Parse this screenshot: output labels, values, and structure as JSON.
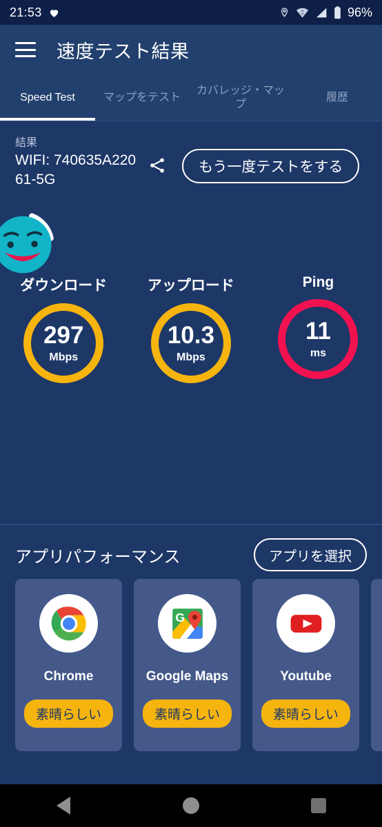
{
  "status_bar": {
    "time": "21:53",
    "battery_percent": "96%",
    "icons": [
      "heart-icon",
      "location-pin-icon",
      "wifi-icon",
      "cellular-signal-icon",
      "battery-icon"
    ]
  },
  "app_bar": {
    "menu_icon": "hamburger-menu-icon",
    "title": "速度テスト結果"
  },
  "tabs": [
    {
      "label": "Speed Test",
      "active": true
    },
    {
      "label": "マップをテスト",
      "active": false
    },
    {
      "label": "カバレッジ・マップ",
      "active": false
    },
    {
      "label": "履歴",
      "active": false
    }
  ],
  "result": {
    "label": "結果",
    "ssid": "WIFI: 740635A22061-5G",
    "share_icon": "share-icon",
    "retest_label": "もう一度テストをする"
  },
  "mascot": {
    "name": "happy-face-mascot",
    "face_color": "#12b4c8",
    "mouth_color": "#e8174a"
  },
  "gauges": [
    {
      "label": "ダウンロード",
      "value": "297",
      "unit": "Mbps",
      "color": "#f6b40f"
    },
    {
      "label": "アップロード",
      "value": "10.3",
      "unit": "Mbps",
      "color": "#f6b40f"
    },
    {
      "label": "Ping",
      "value": "11",
      "unit": "ms",
      "color": "#f2124f"
    }
  ],
  "app_performance": {
    "title": "アプリパフォーマンス",
    "select_button_label": "アプリを選択",
    "cards": [
      {
        "name": "Chrome",
        "icon": "chrome-icon",
        "rating": "素晴らしい"
      },
      {
        "name": "Google Maps",
        "icon": "google-maps-icon",
        "rating": "素晴らしい"
      },
      {
        "name": "Youtube",
        "icon": "youtube-icon",
        "rating": "素晴らしい"
      }
    ]
  },
  "nav_bar": {
    "back": "back-icon",
    "home": "home-icon",
    "recents": "recents-icon"
  }
}
